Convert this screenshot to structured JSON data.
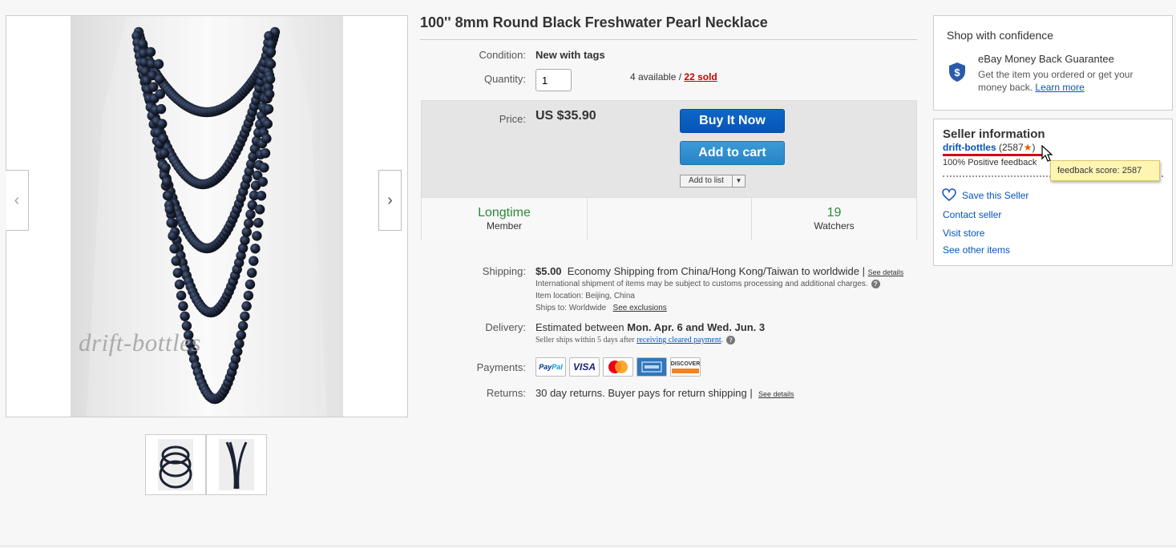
{
  "gallery": {
    "watermark": "drift-bottles",
    "prev_arrow": "‹",
    "next_arrow": "›",
    "thumbnails": [
      "necklace-layered-thumb",
      "necklace-draped-thumb"
    ]
  },
  "item": {
    "title": "100'' 8mm Round Black Freshwater Pearl Necklace",
    "condition_label": "Condition:",
    "condition_value": "New with tags",
    "quantity_label": "Quantity:",
    "quantity_value": "1",
    "available": "4 available / ",
    "sold": "22 sold"
  },
  "price": {
    "label": "Price:",
    "value": "US $35.90",
    "buy_now": "Buy It Now",
    "add_to_cart": "Add to cart",
    "add_to_list": "Add to list",
    "list_arrow": "▼"
  },
  "stats": [
    {
      "big": "Longtime",
      "small": "Member"
    },
    {
      "big": "",
      "small": ""
    },
    {
      "big": "19",
      "small": "Watchers"
    }
  ],
  "shipping": {
    "label": "Shipping:",
    "cost": "$5.00",
    "method": "Economy Shipping from China/Hong Kong/Taiwan to worldwide |",
    "see_details": "See details",
    "customs_note": "International shipment of items may be subject to customs processing and additional charges.",
    "location": "Item location:  Beijing, China",
    "ships_to": "Ships to:  Worldwide",
    "exclusions": "See exclusions"
  },
  "delivery": {
    "label": "Delivery:",
    "prefix": "Estimated between ",
    "dates": "Mon. Apr. 6 and Wed. Jun. 3",
    "note_prefix": "Seller ships within 5 days after ",
    "note_link": "receiving cleared payment",
    "note_suffix": "."
  },
  "payments": {
    "label": "Payments:",
    "methods": [
      "PayPal",
      "VISA",
      "MC",
      "AMEX",
      "DISCOVER"
    ]
  },
  "returns": {
    "label": "Returns:",
    "text": "30 day returns. Buyer pays for return shipping |",
    "see_details": "See details"
  },
  "confidence": {
    "title": "Shop with confidence",
    "heading": "eBay Money Back Guarantee",
    "body": "Get the item you ordered or get your money back.",
    "learn_more": "Learn more",
    "icon_symbol": "$"
  },
  "seller": {
    "title": "Seller information",
    "name": "drift-bottles",
    "score_open": "(2587",
    "score_close": ")",
    "positive": "100% Positive feedback",
    "save": "Save this Seller",
    "contact": "Contact seller",
    "visit": "Visit store",
    "other": "See other items",
    "tooltip": "feedback score: 2587"
  },
  "colors": {
    "buy_button": "#0654ba",
    "cart_button": "#3498db",
    "link": "#0654ba",
    "sold_red": "#cc0000",
    "longtime_green": "#2a8a3a",
    "tooltip_bg": "#fff5b3"
  }
}
